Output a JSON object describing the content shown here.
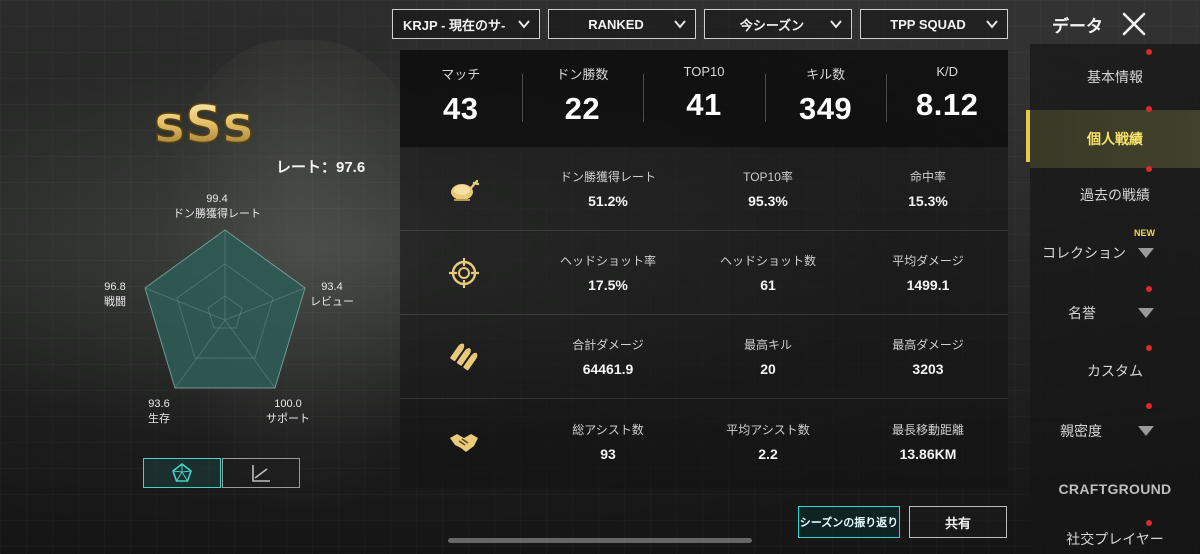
{
  "filters": [
    {
      "label": "KRJP - 現在のサ-"
    },
    {
      "label": "RANKED"
    },
    {
      "label": "今シーズン"
    },
    {
      "label": "TPP SQUAD"
    }
  ],
  "header": {
    "title": "データ"
  },
  "summary": [
    {
      "label": "マッチ",
      "value": "43"
    },
    {
      "label": "ドン勝数",
      "value": "22"
    },
    {
      "label": "TOP10",
      "value": "41"
    },
    {
      "label": "キル数",
      "value": "349"
    },
    {
      "label": "K/D",
      "value": "8.12"
    }
  ],
  "rows": [
    {
      "icon": "chicken-icon",
      "cells": [
        {
          "label": "ドン勝獲得レート",
          "value": "51.2%"
        },
        {
          "label": "TOP10率",
          "value": "95.3%"
        },
        {
          "label": "命中率",
          "value": "15.3%"
        }
      ]
    },
    {
      "icon": "crosshair-icon",
      "cells": [
        {
          "label": "ヘッドショット率",
          "value": "17.5%"
        },
        {
          "label": "ヘッドショット数",
          "value": "61"
        },
        {
          "label": "平均ダメージ",
          "value": "1499.1"
        }
      ]
    },
    {
      "icon": "bullets-icon",
      "cells": [
        {
          "label": "合計ダメージ",
          "value": "64461.9"
        },
        {
          "label": "最高キル",
          "value": "20"
        },
        {
          "label": "最高ダメージ",
          "value": "3203"
        }
      ]
    },
    {
      "icon": "handshake-icon",
      "cells": [
        {
          "label": "総アシスト数",
          "value": "93"
        },
        {
          "label": "平均アシスト数",
          "value": "2.2"
        },
        {
          "label": "最長移動距離",
          "value": "13.86KM"
        }
      ]
    }
  ],
  "buttons": {
    "season_review": "シーズンの振り返り",
    "share": "共有"
  },
  "profile": {
    "rank": "sSs",
    "rate_label": "レート：97.6",
    "radar": {
      "axes": [
        {
          "name": "ドン勝獲得レート",
          "value": "99.4"
        },
        {
          "name": "レビュー",
          "value": "93.4"
        },
        {
          "name": "サポート",
          "value": "100.0"
        },
        {
          "name": "生存",
          "value": "93.6"
        },
        {
          "name": "戦闘",
          "value": "96.8"
        }
      ]
    }
  },
  "sidebar": {
    "items": [
      {
        "label": "基本情報"
      },
      {
        "label": "個人戦績"
      },
      {
        "label": "過去の戦績"
      },
      {
        "label": "コレクション",
        "badge": "NEW"
      },
      {
        "label": "名誉"
      },
      {
        "label": "カスタム"
      },
      {
        "label": "親密度"
      },
      {
        "label": "CRAFTGROUND"
      },
      {
        "label": "社交プレイヤー"
      }
    ]
  },
  "colors": {
    "accent_gold": "#f8e26a",
    "accent_teal": "#32d5d5",
    "notification_red": "#e02a2a"
  }
}
